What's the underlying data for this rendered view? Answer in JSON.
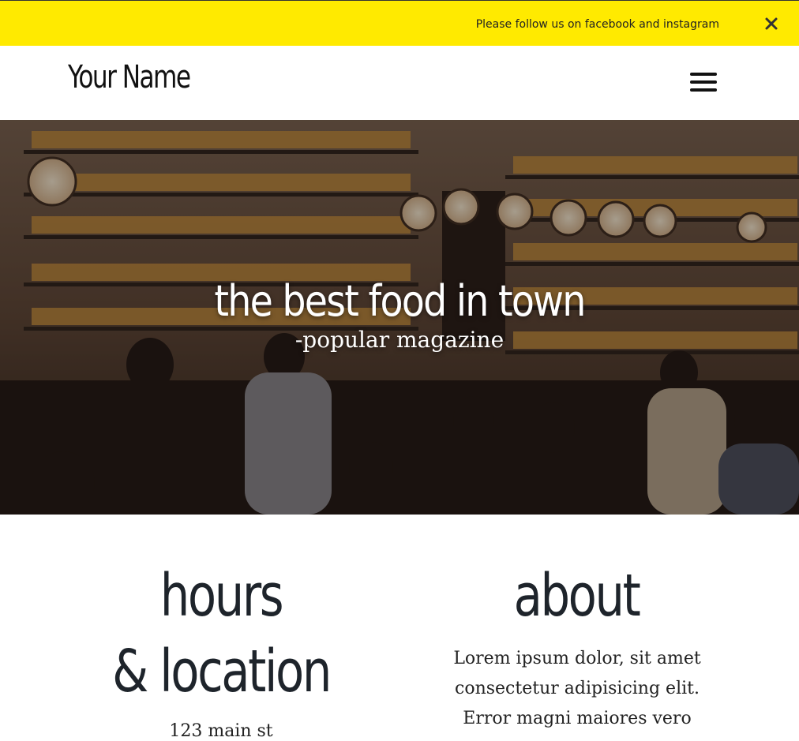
{
  "announcement": {
    "text": "Please follow us on facebook and instagram",
    "close_icon": "close-icon"
  },
  "header": {
    "brand": "Your Name",
    "menu_icon": "hamburger-menu-icon"
  },
  "hero": {
    "title": "the best food in town",
    "subtitle": "-popular magazine"
  },
  "hours": {
    "heading_line1": "hours",
    "heading_line2": "& location",
    "address": "123 main st"
  },
  "about": {
    "heading": "about",
    "text": "Lorem ipsum dolor, sit amet consectetur adipisicing elit. Error magni maiores vero"
  },
  "colors": {
    "announcement_bg": "#ffea00",
    "heading_text": "#1e242b",
    "hero_text": "#ffffff"
  }
}
